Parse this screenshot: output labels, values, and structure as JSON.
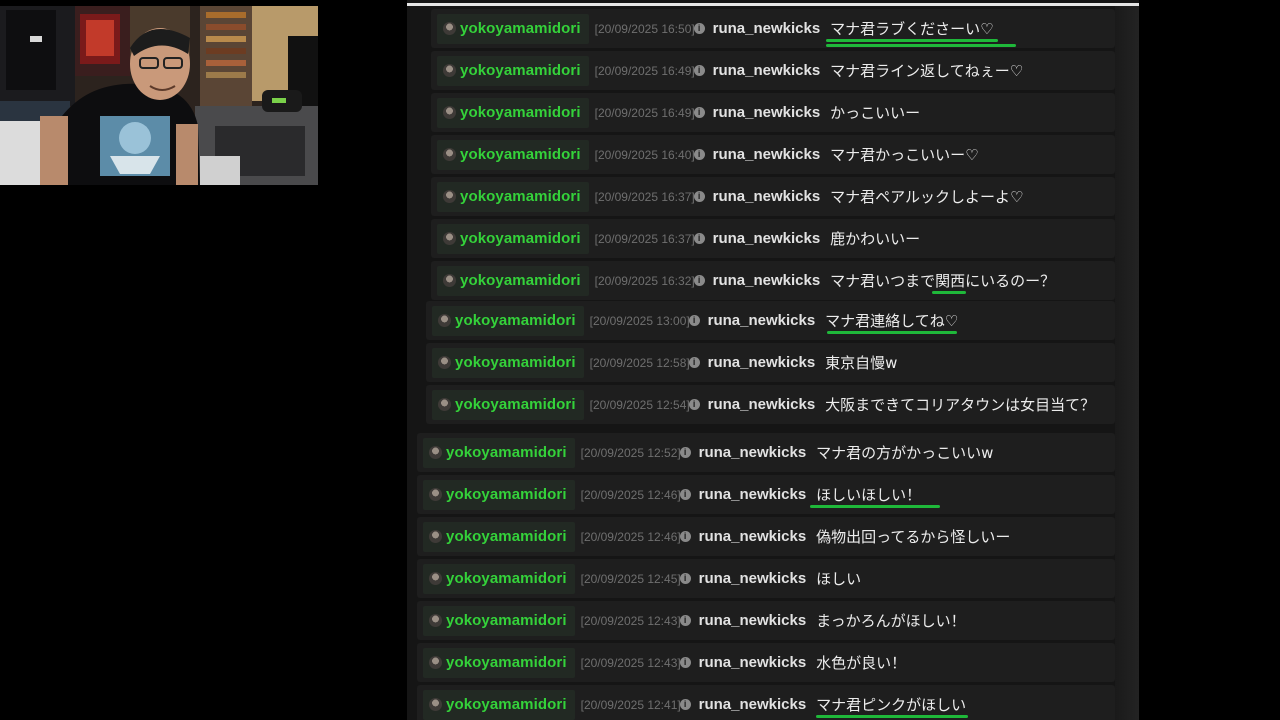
{
  "chat": {
    "messages": [
      {
        "user": "yokoyamamidori",
        "time": "[20/09/2025 16:50]",
        "sender": "runa_newkicks",
        "text": "マナ君ラブくださーい♡"
      },
      {
        "user": "yokoyamamidori",
        "time": "[20/09/2025 16:49]",
        "sender": "runa_newkicks",
        "text": "マナ君ライン返してねぇー♡"
      },
      {
        "user": "yokoyamamidori",
        "time": "[20/09/2025 16:49]",
        "sender": "runa_newkicks",
        "text": "かっこいいー"
      },
      {
        "user": "yokoyamamidori",
        "time": "[20/09/2025 16:40]",
        "sender": "runa_newkicks",
        "text": "マナ君かっこいいー♡"
      },
      {
        "user": "yokoyamamidori",
        "time": "[20/09/2025 16:37]",
        "sender": "runa_newkicks",
        "text": "マナ君ペアルックしよーよ♡"
      },
      {
        "user": "yokoyamamidori",
        "time": "[20/09/2025 16:37]",
        "sender": "runa_newkicks",
        "text": "鹿かわいいー"
      },
      {
        "user": "yokoyamamidori",
        "time": "[20/09/2025 16:32]",
        "sender": "runa_newkicks",
        "text": "マナ君いつまで関西にいるのー？"
      },
      {
        "user": "yokoyamamidori",
        "time": "[20/09/2025 13:00]",
        "sender": "runa_newkicks",
        "text": "マナ君連絡してね♡"
      },
      {
        "user": "yokoyamamidori",
        "time": "[20/09/2025 12:58]",
        "sender": "runa_newkicks",
        "text": "東京自慢w"
      },
      {
        "user": "yokoyamamidori",
        "time": "[20/09/2025 12:54]",
        "sender": "runa_newkicks",
        "text": "大阪まできてコリアタウンは女目当て？"
      },
      {
        "user": "yokoyamamidori",
        "time": "[20/09/2025 12:52]",
        "sender": "runa_newkicks",
        "text": "マナ君の方がかっこいいw"
      },
      {
        "user": "yokoyamamidori",
        "time": "[20/09/2025 12:46]",
        "sender": "runa_newkicks",
        "text": "ほしいほしい！"
      },
      {
        "user": "yokoyamamidori",
        "time": "[20/09/2025 12:46]",
        "sender": "runa_newkicks",
        "text": "偽物出回ってるから怪しいー"
      },
      {
        "user": "yokoyamamidori",
        "time": "[20/09/2025 12:45]",
        "sender": "runa_newkicks",
        "text": "ほしい"
      },
      {
        "user": "yokoyamamidori",
        "time": "[20/09/2025 12:43]",
        "sender": "runa_newkicks",
        "text": "まっかろんがほしい！"
      },
      {
        "user": "yokoyamamidori",
        "time": "[20/09/2025 12:43]",
        "sender": "runa_newkicks",
        "text": "水色が良い！"
      },
      {
        "user": "yokoyamamidori",
        "time": "[20/09/2025 12:41]",
        "sender": "runa_newkicks",
        "text": "マナ君ピンクがほしい"
      }
    ]
  },
  "colors": {
    "username": "#34d23a",
    "underline": "#1fb83a",
    "panel": "#151515"
  },
  "icons": {
    "info": "info-icon",
    "avatar": "avatar"
  }
}
